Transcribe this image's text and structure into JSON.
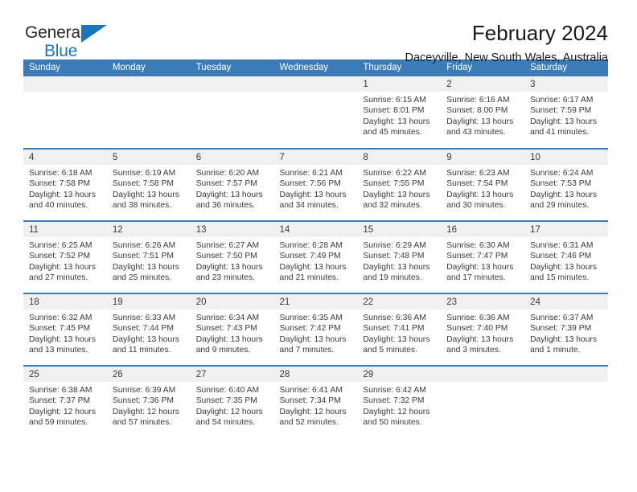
{
  "brand": {
    "name_part1": "General",
    "name_part2": "Blue",
    "accent_color": "#1b75bb"
  },
  "header": {
    "title": "February 2024",
    "subtitle": "Daceyville, New South Wales, Australia"
  },
  "theme": {
    "header_blue": "#3b7cb8",
    "daynum_band": "#f0f0f0",
    "text": "#3a3a3a"
  },
  "weekdays": [
    "Sunday",
    "Monday",
    "Tuesday",
    "Wednesday",
    "Thursday",
    "Friday",
    "Saturday"
  ],
  "weeks": [
    [
      {
        "day": "",
        "sunrise": "",
        "sunset": "",
        "daylight1": "",
        "daylight2": ""
      },
      {
        "day": "",
        "sunrise": "",
        "sunset": "",
        "daylight1": "",
        "daylight2": ""
      },
      {
        "day": "",
        "sunrise": "",
        "sunset": "",
        "daylight1": "",
        "daylight2": ""
      },
      {
        "day": "",
        "sunrise": "",
        "sunset": "",
        "daylight1": "",
        "daylight2": ""
      },
      {
        "day": "1",
        "sunrise": "Sunrise: 6:15 AM",
        "sunset": "Sunset: 8:01 PM",
        "daylight1": "Daylight: 13 hours",
        "daylight2": "and 45 minutes."
      },
      {
        "day": "2",
        "sunrise": "Sunrise: 6:16 AM",
        "sunset": "Sunset: 8:00 PM",
        "daylight1": "Daylight: 13 hours",
        "daylight2": "and 43 minutes."
      },
      {
        "day": "3",
        "sunrise": "Sunrise: 6:17 AM",
        "sunset": "Sunset: 7:59 PM",
        "daylight1": "Daylight: 13 hours",
        "daylight2": "and 41 minutes."
      }
    ],
    [
      {
        "day": "4",
        "sunrise": "Sunrise: 6:18 AM",
        "sunset": "Sunset: 7:58 PM",
        "daylight1": "Daylight: 13 hours",
        "daylight2": "and 40 minutes."
      },
      {
        "day": "5",
        "sunrise": "Sunrise: 6:19 AM",
        "sunset": "Sunset: 7:58 PM",
        "daylight1": "Daylight: 13 hours",
        "daylight2": "and 38 minutes."
      },
      {
        "day": "6",
        "sunrise": "Sunrise: 6:20 AM",
        "sunset": "Sunset: 7:57 PM",
        "daylight1": "Daylight: 13 hours",
        "daylight2": "and 36 minutes."
      },
      {
        "day": "7",
        "sunrise": "Sunrise: 6:21 AM",
        "sunset": "Sunset: 7:56 PM",
        "daylight1": "Daylight: 13 hours",
        "daylight2": "and 34 minutes."
      },
      {
        "day": "8",
        "sunrise": "Sunrise: 6:22 AM",
        "sunset": "Sunset: 7:55 PM",
        "daylight1": "Daylight: 13 hours",
        "daylight2": "and 32 minutes."
      },
      {
        "day": "9",
        "sunrise": "Sunrise: 6:23 AM",
        "sunset": "Sunset: 7:54 PM",
        "daylight1": "Daylight: 13 hours",
        "daylight2": "and 30 minutes."
      },
      {
        "day": "10",
        "sunrise": "Sunrise: 6:24 AM",
        "sunset": "Sunset: 7:53 PM",
        "daylight1": "Daylight: 13 hours",
        "daylight2": "and 29 minutes."
      }
    ],
    [
      {
        "day": "11",
        "sunrise": "Sunrise: 6:25 AM",
        "sunset": "Sunset: 7:52 PM",
        "daylight1": "Daylight: 13 hours",
        "daylight2": "and 27 minutes."
      },
      {
        "day": "12",
        "sunrise": "Sunrise: 6:26 AM",
        "sunset": "Sunset: 7:51 PM",
        "daylight1": "Daylight: 13 hours",
        "daylight2": "and 25 minutes."
      },
      {
        "day": "13",
        "sunrise": "Sunrise: 6:27 AM",
        "sunset": "Sunset: 7:50 PM",
        "daylight1": "Daylight: 13 hours",
        "daylight2": "and 23 minutes."
      },
      {
        "day": "14",
        "sunrise": "Sunrise: 6:28 AM",
        "sunset": "Sunset: 7:49 PM",
        "daylight1": "Daylight: 13 hours",
        "daylight2": "and 21 minutes."
      },
      {
        "day": "15",
        "sunrise": "Sunrise: 6:29 AM",
        "sunset": "Sunset: 7:48 PM",
        "daylight1": "Daylight: 13 hours",
        "daylight2": "and 19 minutes."
      },
      {
        "day": "16",
        "sunrise": "Sunrise: 6:30 AM",
        "sunset": "Sunset: 7:47 PM",
        "daylight1": "Daylight: 13 hours",
        "daylight2": "and 17 minutes."
      },
      {
        "day": "17",
        "sunrise": "Sunrise: 6:31 AM",
        "sunset": "Sunset: 7:46 PM",
        "daylight1": "Daylight: 13 hours",
        "daylight2": "and 15 minutes."
      }
    ],
    [
      {
        "day": "18",
        "sunrise": "Sunrise: 6:32 AM",
        "sunset": "Sunset: 7:45 PM",
        "daylight1": "Daylight: 13 hours",
        "daylight2": "and 13 minutes."
      },
      {
        "day": "19",
        "sunrise": "Sunrise: 6:33 AM",
        "sunset": "Sunset: 7:44 PM",
        "daylight1": "Daylight: 13 hours",
        "daylight2": "and 11 minutes."
      },
      {
        "day": "20",
        "sunrise": "Sunrise: 6:34 AM",
        "sunset": "Sunset: 7:43 PM",
        "daylight1": "Daylight: 13 hours",
        "daylight2": "and 9 minutes."
      },
      {
        "day": "21",
        "sunrise": "Sunrise: 6:35 AM",
        "sunset": "Sunset: 7:42 PM",
        "daylight1": "Daylight: 13 hours",
        "daylight2": "and 7 minutes."
      },
      {
        "day": "22",
        "sunrise": "Sunrise: 6:36 AM",
        "sunset": "Sunset: 7:41 PM",
        "daylight1": "Daylight: 13 hours",
        "daylight2": "and 5 minutes."
      },
      {
        "day": "23",
        "sunrise": "Sunrise: 6:36 AM",
        "sunset": "Sunset: 7:40 PM",
        "daylight1": "Daylight: 13 hours",
        "daylight2": "and 3 minutes."
      },
      {
        "day": "24",
        "sunrise": "Sunrise: 6:37 AM",
        "sunset": "Sunset: 7:39 PM",
        "daylight1": "Daylight: 13 hours",
        "daylight2": "and 1 minute."
      }
    ],
    [
      {
        "day": "25",
        "sunrise": "Sunrise: 6:38 AM",
        "sunset": "Sunset: 7:37 PM",
        "daylight1": "Daylight: 12 hours",
        "daylight2": "and 59 minutes."
      },
      {
        "day": "26",
        "sunrise": "Sunrise: 6:39 AM",
        "sunset": "Sunset: 7:36 PM",
        "daylight1": "Daylight: 12 hours",
        "daylight2": "and 57 minutes."
      },
      {
        "day": "27",
        "sunrise": "Sunrise: 6:40 AM",
        "sunset": "Sunset: 7:35 PM",
        "daylight1": "Daylight: 12 hours",
        "daylight2": "and 54 minutes."
      },
      {
        "day": "28",
        "sunrise": "Sunrise: 6:41 AM",
        "sunset": "Sunset: 7:34 PM",
        "daylight1": "Daylight: 12 hours",
        "daylight2": "and 52 minutes."
      },
      {
        "day": "29",
        "sunrise": "Sunrise: 6:42 AM",
        "sunset": "Sunset: 7:32 PM",
        "daylight1": "Daylight: 12 hours",
        "daylight2": "and 50 minutes."
      },
      {
        "day": "",
        "sunrise": "",
        "sunset": "",
        "daylight1": "",
        "daylight2": ""
      },
      {
        "day": "",
        "sunrise": "",
        "sunset": "",
        "daylight1": "",
        "daylight2": ""
      }
    ]
  ]
}
